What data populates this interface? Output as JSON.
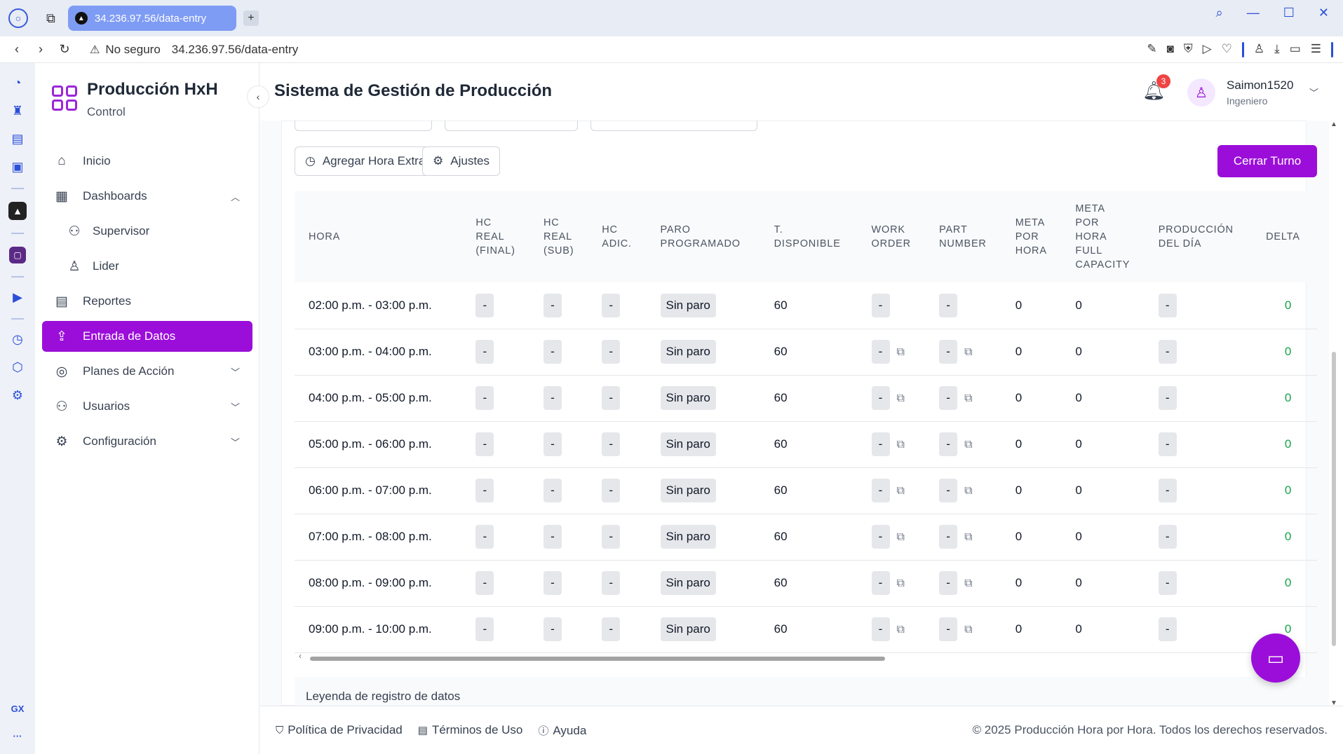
{
  "browser": {
    "tab_title": "34.236.97.56/data-entry",
    "new_tab": "+",
    "security_label": "No seguro",
    "url": "34.236.97.56/data-entry"
  },
  "sidebar": {
    "brand_title": "Producción HxH",
    "brand_subtitle": "Control",
    "items": [
      {
        "label": "Inicio",
        "icon": "home-icon"
      },
      {
        "label": "Dashboards",
        "icon": "dashboard-icon"
      },
      {
        "label": "Supervisor",
        "icon": "users-icon"
      },
      {
        "label": "Lider",
        "icon": "user-icon"
      },
      {
        "label": "Reportes",
        "icon": "report-icon"
      },
      {
        "label": "Entrada de Datos",
        "icon": "upload-icon"
      },
      {
        "label": "Planes de Acción",
        "icon": "target-icon"
      },
      {
        "label": "Usuarios",
        "icon": "users-icon"
      },
      {
        "label": "Configuración",
        "icon": "gear-icon"
      }
    ]
  },
  "header": {
    "title": "Sistema de Gestión de Producción",
    "notification_count": "3",
    "user_name": "Saimon1520",
    "user_role": "Ingeniero"
  },
  "toolbar": {
    "add_overtime": "Agregar Hora Extra",
    "settings": "Ajustes",
    "close_shift": "Cerrar Turno"
  },
  "table": {
    "headers": [
      [
        "HORA"
      ],
      [
        "HC",
        "REAL",
        "(FINAL)"
      ],
      [
        "HC",
        "REAL",
        "(SUB)"
      ],
      [
        "HC",
        "ADIC."
      ],
      [
        "PARO",
        "PROGRAMADO"
      ],
      [
        "T.",
        "DISPONIBLE"
      ],
      [
        "WORK",
        "ORDER"
      ],
      [
        "PART",
        "NUMBER"
      ],
      [
        "META",
        "POR",
        "HORA"
      ],
      [
        "META",
        "POR",
        "HORA",
        "FULL",
        "CAPACITY"
      ],
      [
        "PRODUCCIÓN",
        "DEL DÍA"
      ],
      [
        "DELTA"
      ]
    ],
    "rows": [
      {
        "hora": "02:00 p.m. - 03:00 p.m.",
        "hc_final": "-",
        "hc_sub": "-",
        "hc_adic": "-",
        "paro": "Sin paro",
        "disponible": "60",
        "work_order": "-",
        "part_number": "-",
        "meta": "0",
        "meta_full": "0",
        "produccion": "-",
        "delta": "0"
      },
      {
        "hora": "03:00 p.m. - 04:00 p.m.",
        "hc_final": "-",
        "hc_sub": "-",
        "hc_adic": "-",
        "paro": "Sin paro",
        "disponible": "60",
        "work_order": "-",
        "part_number": "-",
        "meta": "0",
        "meta_full": "0",
        "produccion": "-",
        "delta": "0"
      },
      {
        "hora": "04:00 p.m. - 05:00 p.m.",
        "hc_final": "-",
        "hc_sub": "-",
        "hc_adic": "-",
        "paro": "Sin paro",
        "disponible": "60",
        "work_order": "-",
        "part_number": "-",
        "meta": "0",
        "meta_full": "0",
        "produccion": "-",
        "delta": "0"
      },
      {
        "hora": "05:00 p.m. - 06:00 p.m.",
        "hc_final": "-",
        "hc_sub": "-",
        "hc_adic": "-",
        "paro": "Sin paro",
        "disponible": "60",
        "work_order": "-",
        "part_number": "-",
        "meta": "0",
        "meta_full": "0",
        "produccion": "-",
        "delta": "0"
      },
      {
        "hora": "06:00 p.m. - 07:00 p.m.",
        "hc_final": "-",
        "hc_sub": "-",
        "hc_adic": "-",
        "paro": "Sin paro",
        "disponible": "60",
        "work_order": "-",
        "part_number": "-",
        "meta": "0",
        "meta_full": "0",
        "produccion": "-",
        "delta": "0"
      },
      {
        "hora": "07:00 p.m. - 08:00 p.m.",
        "hc_final": "-",
        "hc_sub": "-",
        "hc_adic": "-",
        "paro": "Sin paro",
        "disponible": "60",
        "work_order": "-",
        "part_number": "-",
        "meta": "0",
        "meta_full": "0",
        "produccion": "-",
        "delta": "0"
      },
      {
        "hora": "08:00 p.m. - 09:00 p.m.",
        "hc_final": "-",
        "hc_sub": "-",
        "hc_adic": "-",
        "paro": "Sin paro",
        "disponible": "60",
        "work_order": "-",
        "part_number": "-",
        "meta": "0",
        "meta_full": "0",
        "produccion": "-",
        "delta": "0"
      },
      {
        "hora": "09:00 p.m. - 10:00 p.m.",
        "hc_final": "-",
        "hc_sub": "-",
        "hc_adic": "-",
        "paro": "Sin paro",
        "disponible": "60",
        "work_order": "-",
        "part_number": "-",
        "meta": "0",
        "meta_full": "0",
        "produccion": "-",
        "delta": "0"
      }
    ]
  },
  "legend": {
    "title": "Leyenda de registro de datos"
  },
  "footer": {
    "privacy": "Política de Privacidad",
    "terms": "Términos de Uso",
    "help": "Ayuda",
    "copyright": "© 2025 Producción Hora por Hora. Todos los derechos reservados."
  },
  "colors": {
    "accent": "#9b0ed9",
    "delta_positive": "#16a34a",
    "badge": "#ef4444"
  }
}
